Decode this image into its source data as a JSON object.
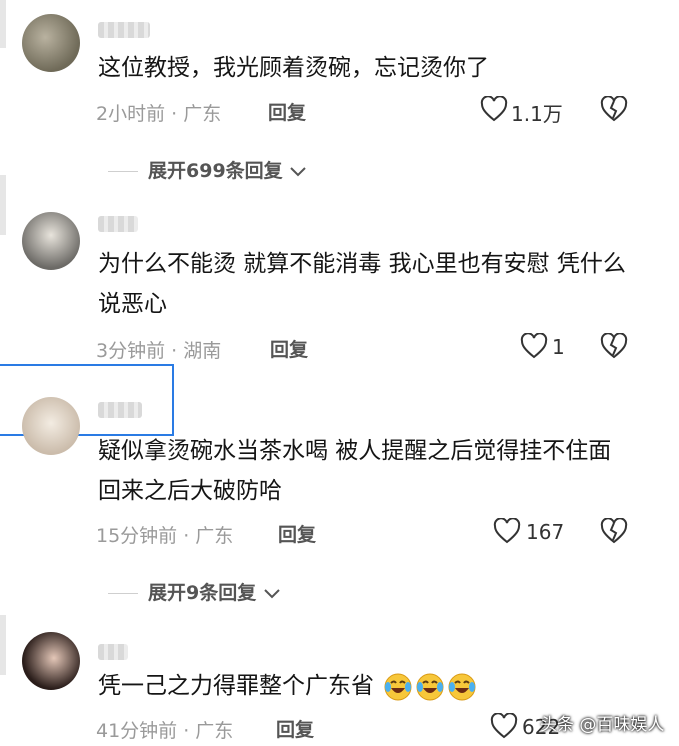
{
  "comments": [
    {
      "text": "这位教授，我光顾着烫碗，忘记烫你了",
      "meta": "2小时前 · 广东",
      "reply": "回复",
      "likes": "1.1万",
      "expand": "展开699条回复"
    },
    {
      "text": "为什么不能烫 就算不能消毒 我心里也有安慰 凭什么说恶心",
      "meta": "3分钟前 · 湖南",
      "reply": "回复",
      "likes": "1"
    },
    {
      "text": "疑似拿烫碗水当茶水喝 被人提醒之后觉得挂不住面 回来之后大破防哈",
      "meta": "15分钟前 · 广东",
      "reply": "回复",
      "likes": "167",
      "expand": "展开9条回复"
    },
    {
      "text": "凭一己之力得罪整个广东省",
      "meta": "41分钟前 · 广东",
      "reply": "回复",
      "likes": "622"
    }
  ],
  "watermark": "头条 @百味娱人",
  "icons": [
    "heart-icon",
    "broken-heart-icon",
    "chevron-down-icon",
    "crying-laughing-emoji-icon"
  ]
}
